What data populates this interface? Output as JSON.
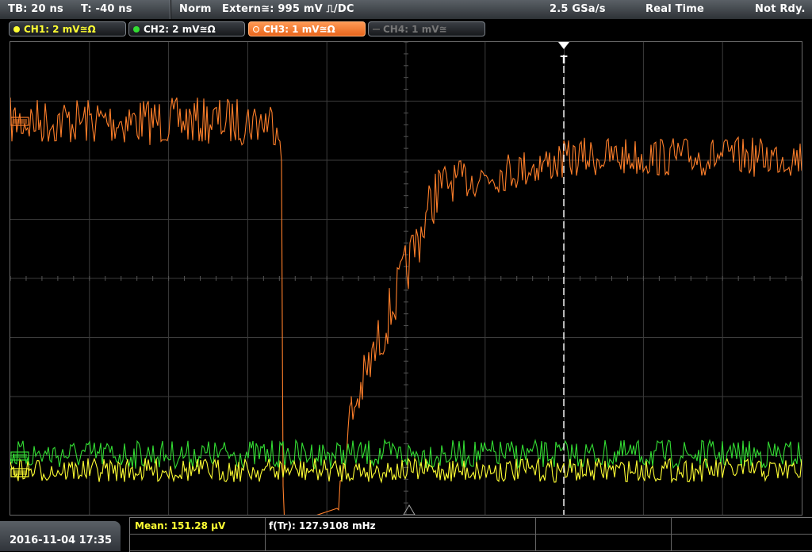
{
  "topbar": {
    "timebase": "TB: 20 ns",
    "trigger_time": "T: -40 ns",
    "trigger_mode": "Norm",
    "trigger_source": "Extern≅: 995 mV ⎍/DC",
    "sample_rate": "2.5 GSa/s",
    "acq_mode": "Real Time",
    "status": "Not Rdy."
  },
  "channels": [
    {
      "label": "CH1: 2 mV≅Ω",
      "color": "#ffff33",
      "active": false
    },
    {
      "label": "CH2: 2 mV≅Ω",
      "color": "#33dd33",
      "active": false
    },
    {
      "label": "CH3: 1 mV≅Ω",
      "color": "#ff8c3a",
      "active": true
    },
    {
      "label": "CH4: 1 mV≅",
      "color": "#777777",
      "active": false
    }
  ],
  "markers": {
    "trigger_marker": "T"
  },
  "measurements": {
    "mean": "Mean: 151.28 µV",
    "frequency": "f(Tr): 127.9108 mHz"
  },
  "datetime": "2016-11-04 17:35",
  "colors": {
    "ch1": "#ffff33",
    "ch2": "#33dd33",
    "ch3": "#ff7f2a",
    "grid": "#3c3c3c",
    "bar": "#464b51"
  }
}
